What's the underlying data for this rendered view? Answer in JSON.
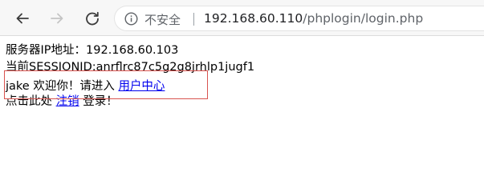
{
  "browser": {
    "security_label": "不安全",
    "url_host": "192.168.60.110",
    "url_path": "/phplogin/login.php",
    "icons": [
      "back-icon",
      "forward-icon",
      "reload-icon",
      "info-icon"
    ]
  },
  "page": {
    "server_ip_line": "服务器IP地址：192.168.60.103",
    "session_line": "当前SESSIONID:anrflrc87c5g2g8jrhlp1jugf1",
    "welcome_text": "jake 欢迎你！请进入",
    "user_center_link": "用户中心",
    "logout_prefix": "点击此处",
    "logout_link": "注销",
    "logout_suffix": "登录！"
  },
  "colors": {
    "link": "#0000ee",
    "highlight_border": "#d9534f"
  }
}
